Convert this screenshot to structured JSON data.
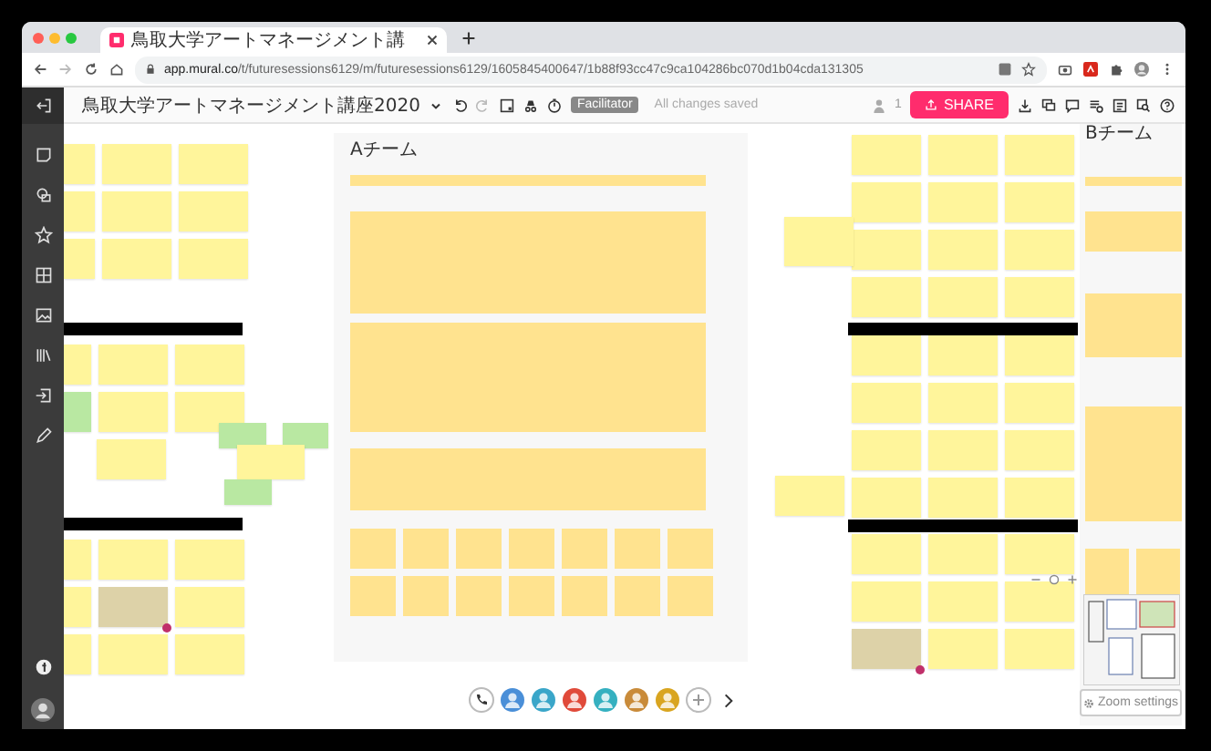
{
  "browser": {
    "tab_title": "鳥取大学アートマネージメント講",
    "url_host": "app.mural.co",
    "url_path": "/t/futuresessions6129/m/futuresessions6129/1605845400647/1b88f93cc47c9ca104286bc070d1b04cda131305"
  },
  "toolbar": {
    "title": "鳥取大学アートマネージメント講座2020",
    "role_badge": "Facilitator",
    "save_status": "All changes saved",
    "user_count": "1",
    "share_label": "SHARE"
  },
  "objects": [
    {
      "kind": "grid",
      "rows": [
        [
          {
            "color": "#fff59b"
          },
          {
            "color": "#fff59b"
          },
          {
            "color": "#fff59b"
          }
        ],
        [
          {
            "color": "#fff59b"
          },
          {
            "color": "#fff59b"
          },
          {
            "color": "#fff59b"
          }
        ],
        [
          {
            "color": "#fff59b"
          },
          {
            "color": "#fff59b"
          },
          {
            "color": "#fff59b"
          }
        ]
      ]
    },
    {
      "kind": "header"
    },
    {
      "kind": "grid",
      "rows": [
        [
          {
            "color": "#fff59b"
          },
          {
            "color": "#fff59b"
          },
          {
            "color": "#fff59b"
          }
        ],
        [
          {
            "color": "#b9e8a2"
          },
          {
            "color": "#fff59b"
          },
          {
            "color": "#fff59b"
          }
        ]
      ]
    },
    {
      "kind": "header"
    },
    {
      "kind": "grid",
      "rows": [
        [
          {
            "color": "#fff59b"
          },
          {
            "color": "#fff59b"
          },
          {
            "color": "#fff59b"
          }
        ],
        [
          {
            "color": "#fff59b"
          },
          {
            "color": "#ddd2a8",
            "comment": true
          },
          {
            "color": "#fff59b"
          }
        ],
        [
          {
            "color": "#fff59b"
          },
          {
            "color": "#fff59b"
          },
          {
            "color": "#fff59b"
          }
        ]
      ]
    },
    {
      "kind": "sticky",
      "color": "#b9e8a2"
    },
    {
      "kind": "sticky",
      "color": "#b9e8a2"
    },
    {
      "kind": "sticky",
      "color": "#fff59b"
    },
    {
      "kind": "sticky",
      "color": "#b9e8a2"
    },
    {
      "kind": "sticky",
      "color": "#fff59b"
    },
    {
      "kind": "panel",
      "title": "Aチーム",
      "sections": [
        {
          "kind": "band"
        },
        {
          "kind": "block"
        },
        {
          "kind": "block"
        },
        {
          "kind": "block"
        },
        {
          "kind": "grid",
          "rows": [
            [
              {
                "color": "#ffe38f"
              },
              {
                "color": "#ffe38f"
              },
              {
                "color": "#ffe38f"
              },
              {
                "color": "#ffe38f"
              },
              {
                "color": "#ffe38f"
              },
              {
                "color": "#ffe38f"
              },
              {
                "color": "#ffe38f"
              }
            ],
            [
              {
                "color": "#ffe38f"
              },
              {
                "color": "#ffe38f"
              },
              {
                "color": "#ffe38f"
              },
              {
                "color": "#ffe38f"
              },
              {
                "color": "#ffe38f"
              },
              {
                "color": "#ffe38f"
              },
              {
                "color": "#ffe38f"
              }
            ]
          ]
        }
      ]
    },
    {
      "kind": "grid",
      "rows": [
        [
          {
            "color": "#fff59b"
          },
          {
            "color": "#fff59b"
          },
          {
            "color": "#fff59b"
          }
        ],
        [
          {
            "color": "#fff59b"
          },
          {
            "color": "#fff59b"
          },
          {
            "color": "#fff59b"
          }
        ],
        [
          {
            "color": "#fff59b"
          },
          {
            "color": "#fff59b"
          },
          {
            "color": "#fff59b"
          }
        ],
        [
          {
            "color": "#fff59b"
          },
          {
            "color": "#fff59b"
          },
          {
            "color": "#fff59b"
          }
        ]
      ]
    },
    {
      "kind": "sticky",
      "color": "#fff59b"
    },
    {
      "kind": "header"
    },
    {
      "kind": "grid",
      "rows": [
        [
          {
            "color": "#fff59b"
          },
          {
            "color": "#fff59b"
          },
          {
            "color": "#fff59b"
          }
        ],
        [
          {
            "color": "#fff59b"
          },
          {
            "color": "#fff59b"
          },
          {
            "color": "#fff59b"
          }
        ],
        [
          {
            "color": "#fff59b"
          },
          {
            "color": "#fff59b"
          },
          {
            "color": "#fff59b"
          }
        ],
        [
          {
            "color": "#fff59b"
          },
          {
            "color": "#fff59b"
          },
          {
            "color": "#fff59b"
          }
        ]
      ]
    },
    {
      "kind": "sticky",
      "color": "#fff59b"
    },
    {
      "kind": "header"
    },
    {
      "kind": "grid",
      "rows": [
        [
          {
            "color": "#fff59b"
          },
          {
            "color": "#fff59b"
          },
          {
            "color": "#fff59b"
          }
        ],
        [
          {
            "color": "#fff59b"
          },
          {
            "color": "#fff59b"
          },
          {
            "color": "#fff59b"
          }
        ],
        [
          {
            "color": "#ddd2a8",
            "comment": true
          },
          {
            "color": "#fff59b"
          },
          {
            "color": "#fff59b"
          }
        ]
      ]
    },
    {
      "kind": "panel",
      "title": "Bチーム",
      "sections": [
        {
          "kind": "band"
        },
        {
          "kind": "block"
        },
        {
          "kind": "block"
        },
        {
          "kind": "block"
        },
        {
          "kind": "grid",
          "rows": [
            [
              {
                "color": "#ffe38f"
              },
              {
                "color": "#ffe38f"
              }
            ]
          ]
        }
      ]
    }
  ],
  "zoom": {
    "settings_label": "Zoom settings"
  }
}
